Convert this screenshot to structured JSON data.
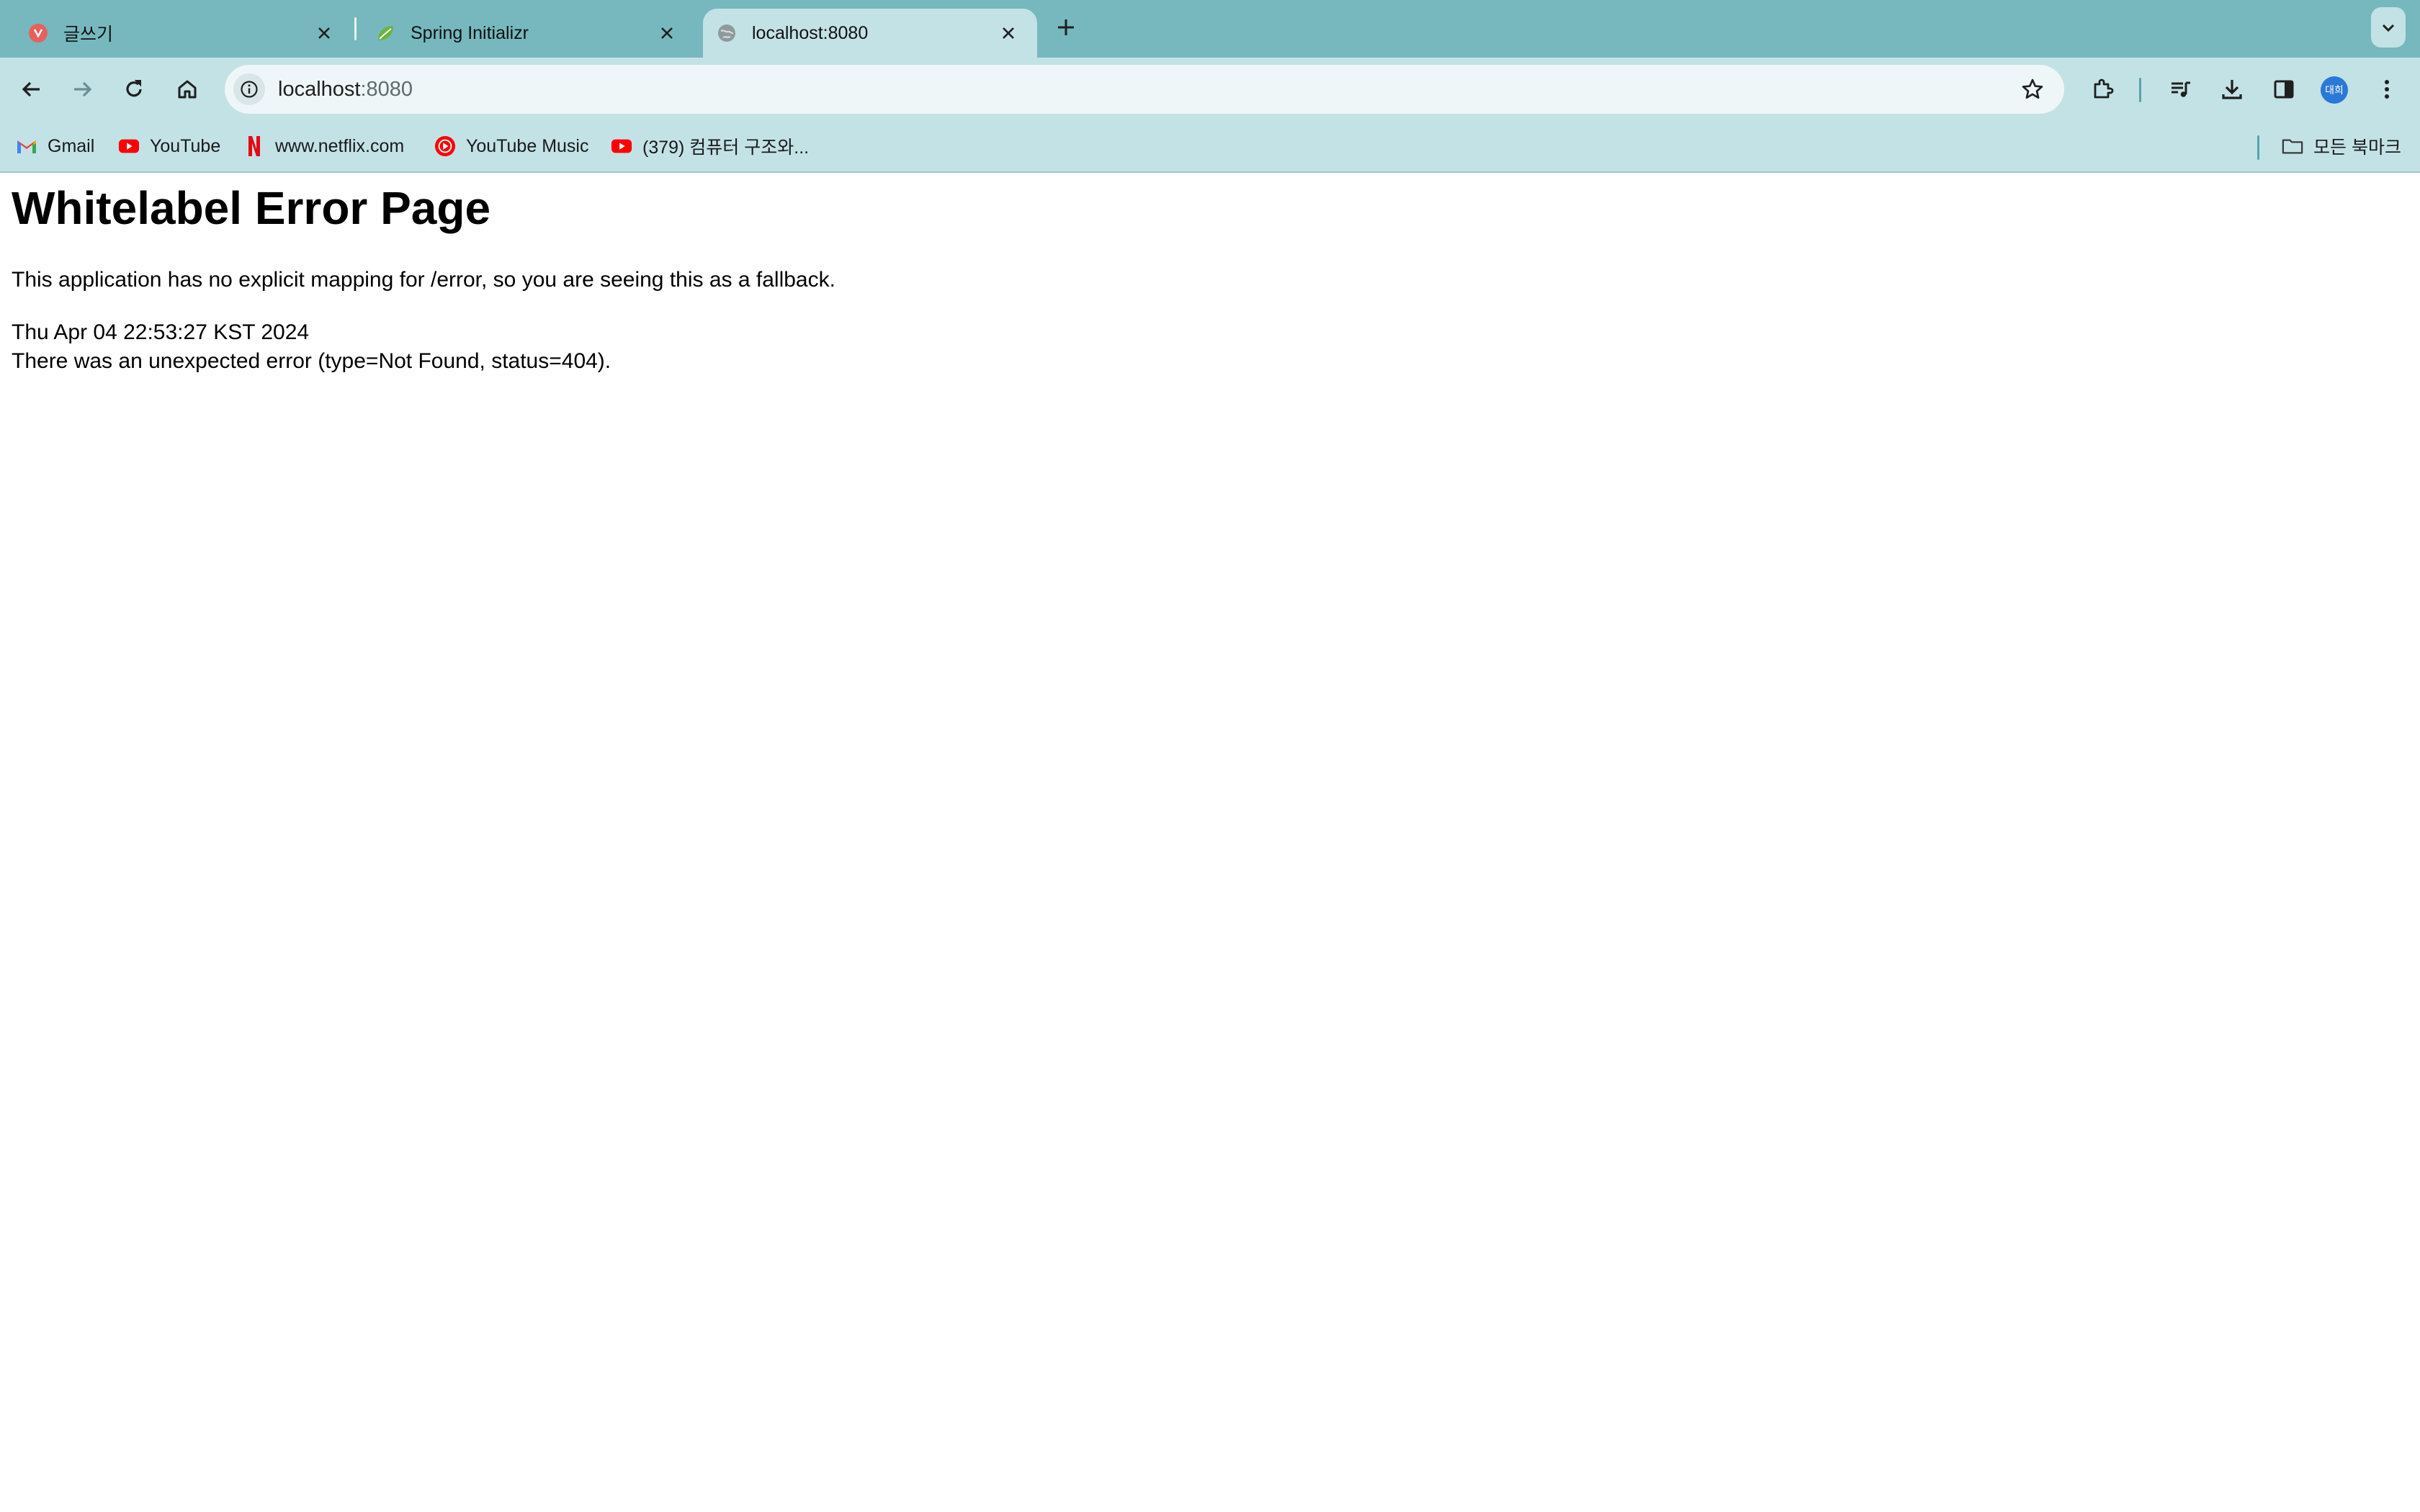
{
  "browser": {
    "tabs": [
      {
        "title": "글쓰기",
        "favicon": "velog-icon",
        "active": false
      },
      {
        "title": "Spring Initializr",
        "favicon": "spring-leaf-icon",
        "active": false
      },
      {
        "title": "localhost:8080",
        "favicon": "globe-icon",
        "active": true
      }
    ],
    "address": {
      "host": "localhost",
      "port": ":8080"
    },
    "profile_initials": "대희",
    "bookmarks": [
      {
        "label": "Gmail",
        "icon": "gmail-icon"
      },
      {
        "label": "YouTube",
        "icon": "youtube-icon"
      },
      {
        "label": "www.netflix.com",
        "icon": "netflix-icon"
      },
      {
        "label": "YouTube Music",
        "icon": "youtube-music-icon"
      },
      {
        "label": "(379) 컴퓨터 구조와...",
        "icon": "youtube-icon"
      }
    ],
    "all_bookmarks_label": "모든 북마크"
  },
  "page": {
    "heading": "Whitelabel Error Page",
    "message": "This application has no explicit mapping for /error, so you are seeing this as a fallback.",
    "timestamp": "Thu Apr 04 22:53:27 KST 2024",
    "error_detail": "There was an unexpected error (type=Not Found, status=404)."
  },
  "colors": {
    "tabstrip_bg": "#76b8be",
    "toolbar_bg": "#c3e2e6",
    "omnibox_bg": "#eef6f7",
    "avatar_bg": "#2b78d6"
  }
}
